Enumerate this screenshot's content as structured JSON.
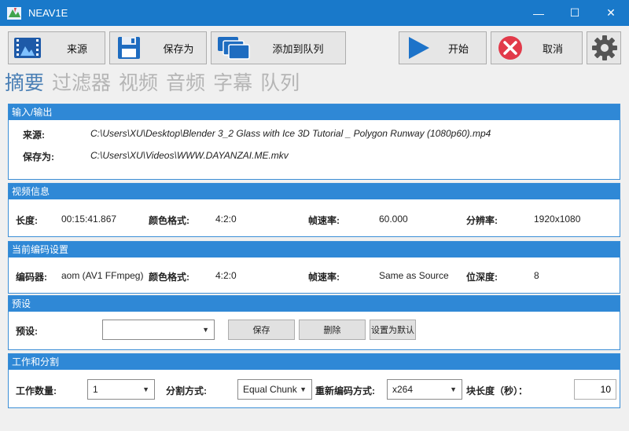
{
  "window": {
    "title": "NEAV1E",
    "min_glyph": "—",
    "max_glyph": "☐",
    "close_glyph": "✕"
  },
  "toolbar": {
    "source_label": "来源",
    "save_as_label": "保存为",
    "add_queue_label": "添加到队列",
    "start_label": "开始",
    "cancel_label": "取消"
  },
  "tabs": [
    {
      "label": "摘要",
      "active": true
    },
    {
      "label": "过滤器"
    },
    {
      "label": "视频"
    },
    {
      "label": "音频"
    },
    {
      "label": "字幕"
    },
    {
      "label": "队列"
    }
  ],
  "io": {
    "header": "输入/输出",
    "source_label": "来源:",
    "source_value": "C:\\Users\\XU\\Desktop\\Blender 3_2 Glass with Ice 3D Tutorial _ Polygon Runway (1080p60).mp4",
    "save_label": "保存为:",
    "save_value": "C:\\Users\\XU\\Videos\\WWW.DAYANZAI.ME.mkv"
  },
  "video_info": {
    "header": "视频信息",
    "length_label": "长度:",
    "length_value": "00:15:41.867",
    "color_label": "颜色格式:",
    "color_value": "4:2:0",
    "fps_label": "帧速率:",
    "fps_value": "60.000",
    "res_label": "分辨率:",
    "res_value": "1920x1080"
  },
  "encode": {
    "header": "当前编码设置",
    "encoder_label": "编码器:",
    "encoder_value": "aom (AV1 FFmpeg)",
    "color_label": "颜色格式:",
    "color_value": "4:2:0",
    "fps_label": "帧速率:",
    "fps_value": "Same as Source",
    "depth_label": "位深度:",
    "depth_value": "8"
  },
  "preset": {
    "header": "预设",
    "label": "预设:",
    "value": "",
    "save_btn": "保存",
    "delete_btn": "删除",
    "default_btn": "设置为默认"
  },
  "work": {
    "header": "工作和分割",
    "workers_label": "工作数量:",
    "workers_value": "1",
    "split_label": "分割方式:",
    "split_value": "Equal Chunk",
    "reencode_label": "重新编码方式:",
    "reencode_value": "x264",
    "chunk_label": "块长度（秒）：",
    "chunk_value": "10"
  },
  "colors": {
    "titlebar": "#1979ca",
    "panel_header": "#2f88d6",
    "active_tab": "#4a7fb5",
    "inactive_tab": "#b5b5b5",
    "start_blue": "#1d73c9",
    "cancel_red": "#e23a4a"
  }
}
